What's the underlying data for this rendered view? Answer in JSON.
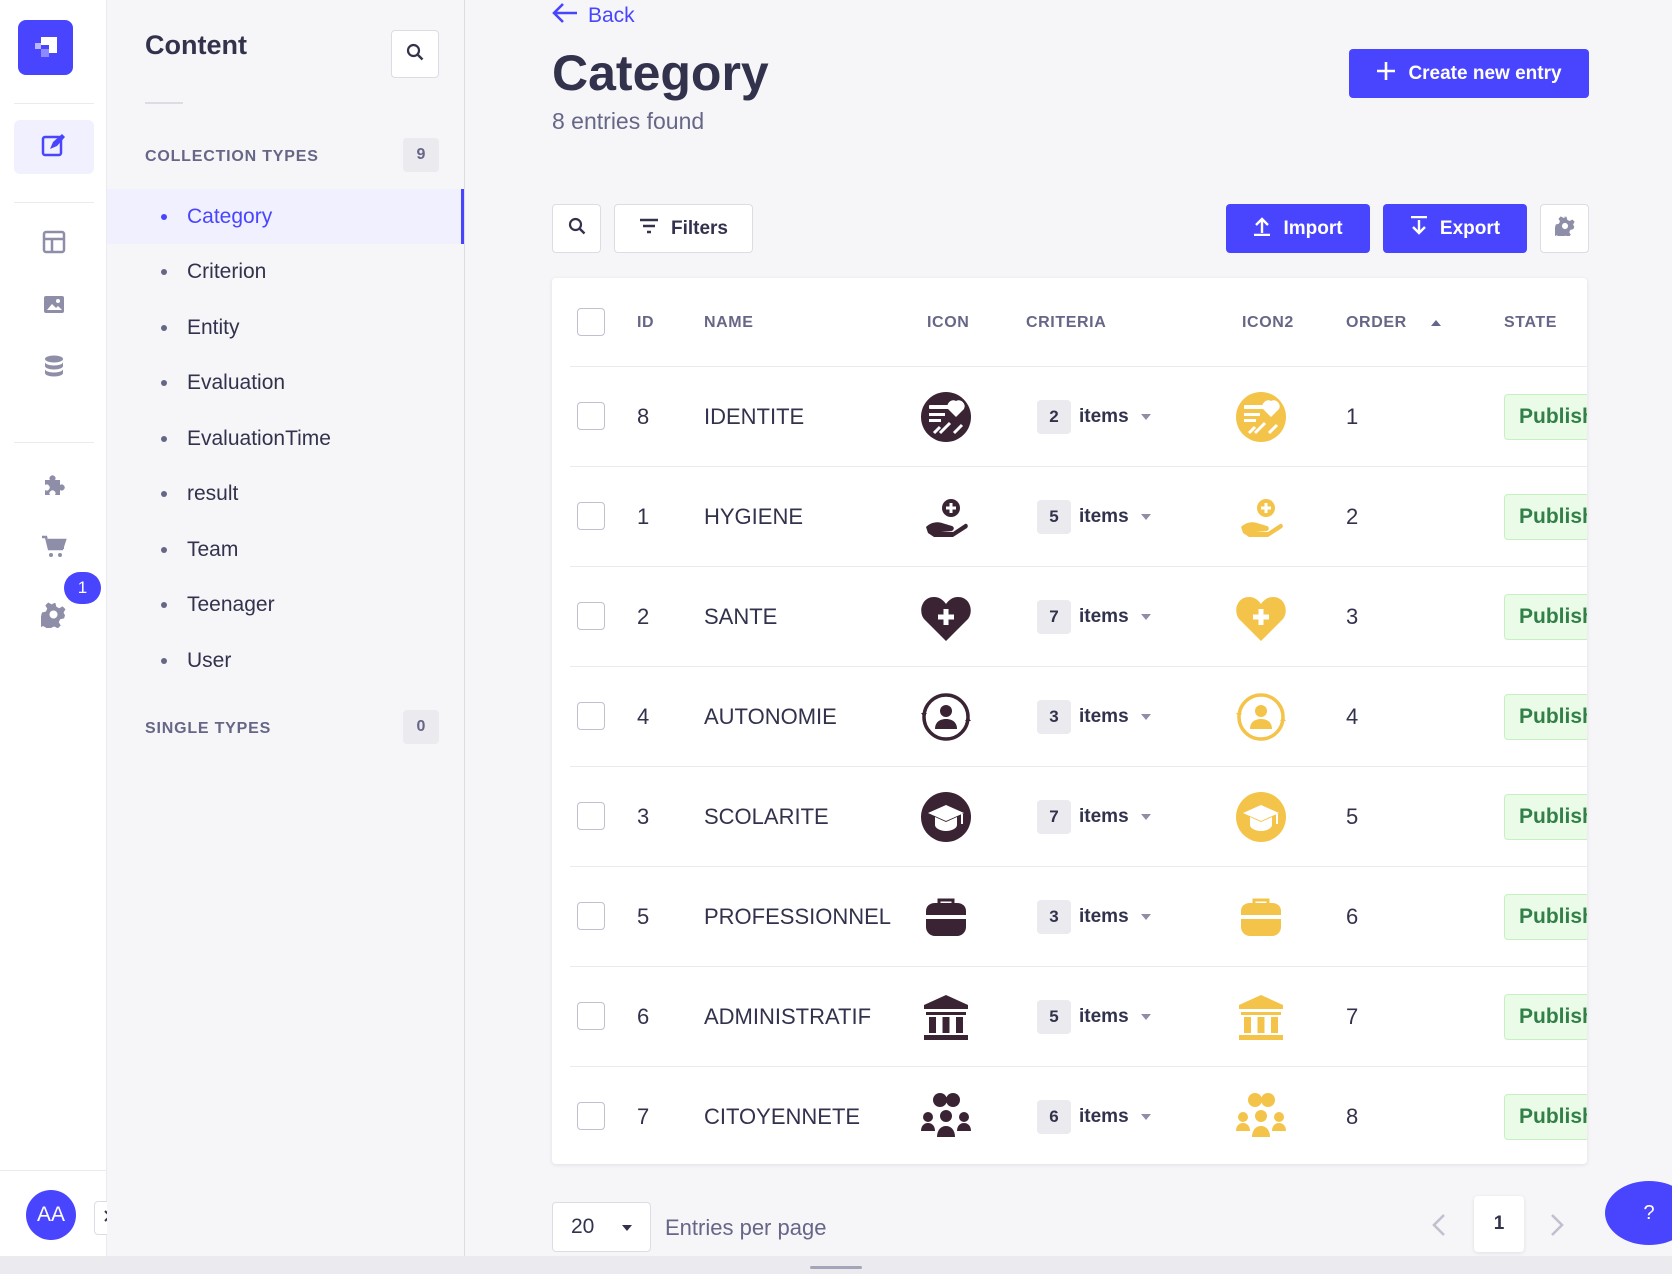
{
  "rail": {
    "badge": "1",
    "avatar_initials": "AA",
    "icons": [
      "content-manager-icon",
      "layout-icon",
      "media-icon",
      "database-icon",
      "plugin-icon",
      "cart-icon",
      "settings-icon"
    ]
  },
  "sidebar": {
    "title": "Content",
    "collection_types_label": "COLLECTION TYPES",
    "collection_types_count": "9",
    "items": [
      "Category",
      "Criterion",
      "Entity",
      "Evaluation",
      "EvaluationTime",
      "result",
      "Team",
      "Teenager",
      "User"
    ],
    "active_item": "Category",
    "single_types_label": "SINGLE TYPES",
    "single_types_count": "0"
  },
  "header": {
    "back_label": "Back",
    "title": "Category",
    "subtitle": "8 entries found",
    "create_label": "Create new entry"
  },
  "toolbar": {
    "filters_label": "Filters",
    "import_label": "Import",
    "export_label": "Export"
  },
  "table": {
    "columns": [
      "ID",
      "NAME",
      "ICON",
      "CRITERIA",
      "ICON2",
      "ORDER",
      "STATE"
    ],
    "rows": [
      {
        "id": "8",
        "name": "IDENTITE",
        "icon": "identity-card-icon",
        "criteria_count": "2",
        "criteria_label": "items",
        "order": "1",
        "state": "Published"
      },
      {
        "id": "1",
        "name": "HYGIENE",
        "icon": "hand-care-icon",
        "criteria_count": "5",
        "criteria_label": "items",
        "order": "2",
        "state": "Published"
      },
      {
        "id": "2",
        "name": "SANTE",
        "icon": "heart-cross-icon",
        "criteria_count": "7",
        "criteria_label": "items",
        "order": "3",
        "state": "Published"
      },
      {
        "id": "4",
        "name": "AUTONOMIE",
        "icon": "person-cycle-icon",
        "criteria_count": "3",
        "criteria_label": "items",
        "order": "4",
        "state": "Published"
      },
      {
        "id": "3",
        "name": "SCOLARITE",
        "icon": "graduation-cap-icon",
        "criteria_count": "7",
        "criteria_label": "items",
        "order": "5",
        "state": "Published"
      },
      {
        "id": "5",
        "name": "PROFESSIONNEL",
        "icon": "briefcase-icon",
        "criteria_count": "3",
        "criteria_label": "items",
        "order": "6",
        "state": "Published"
      },
      {
        "id": "6",
        "name": "ADMINISTRATIF",
        "icon": "institution-icon",
        "criteria_count": "5",
        "criteria_label": "items",
        "order": "7",
        "state": "Published"
      },
      {
        "id": "7",
        "name": "CITOYENNETE",
        "icon": "group-people-icon",
        "criteria_count": "6",
        "criteria_label": "items",
        "order": "8",
        "state": "Published"
      }
    ]
  },
  "footer": {
    "per_page": "20",
    "per_page_label": "Entries per page",
    "current_page": "1",
    "help_label": "?"
  },
  "colors": {
    "primary": "#4945ff",
    "icon_dark": "#3a2434",
    "icon_yellow": "#f4c34a",
    "published_bg": "#eafbe7",
    "published_text": "#328048"
  }
}
